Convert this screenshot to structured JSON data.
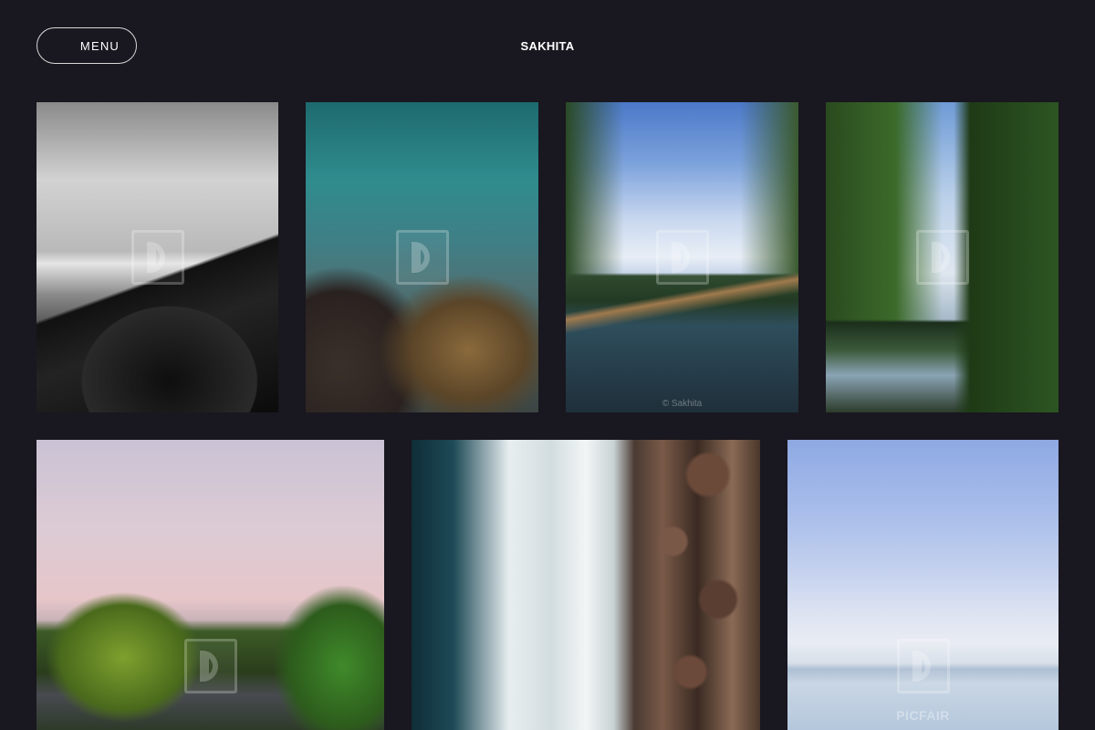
{
  "header": {
    "menu_label": "MENU",
    "brand": "SAKHITA"
  },
  "gallery": {
    "tiles": [
      {
        "subject": "black-and-white rocky coastline",
        "credit": ""
      },
      {
        "subject": "turquoise sea over rocks",
        "credit": ""
      },
      {
        "subject": "canal under blue sky",
        "credit": "© Sakhita"
      },
      {
        "subject": "trees reflected in river",
        "credit": ""
      },
      {
        "subject": "pink sky over trees and river",
        "credit": ""
      },
      {
        "subject": "aerial waves on pebble beach",
        "credit": ""
      },
      {
        "subject": "pale blue sea horizon",
        "credit": "",
        "watermark_label": "PICFAIR"
      }
    ]
  },
  "colors": {
    "background": "#19171f",
    "text": "#ffffff"
  }
}
